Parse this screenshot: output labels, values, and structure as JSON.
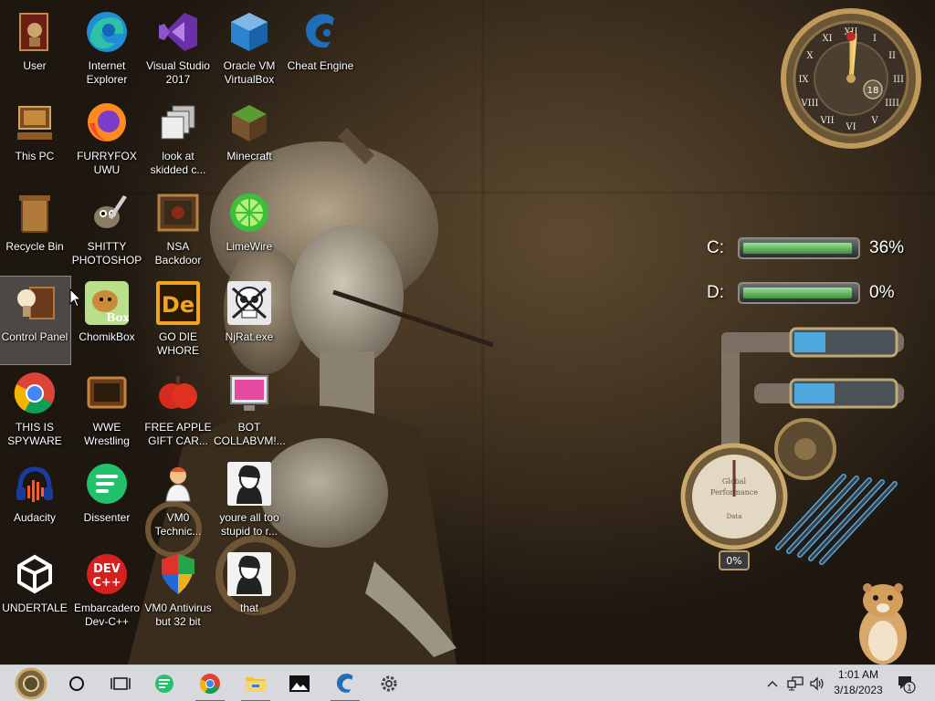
{
  "desktop": {
    "icons": [
      {
        "label": "User",
        "icon": "user-folder-icon"
      },
      {
        "label": "Internet Explorer",
        "icon": "edge-browser-icon"
      },
      {
        "label": "Visual Studio 2017",
        "icon": "visual-studio-icon"
      },
      {
        "label": "Oracle VM VirtualBox",
        "icon": "virtualbox-icon"
      },
      {
        "label": "Cheat Engine",
        "icon": "cheat-engine-icon"
      },
      {
        "label": "This PC",
        "icon": "computer-icon"
      },
      {
        "label": "FURRYFOX UWU",
        "icon": "firefox-icon"
      },
      {
        "label": "look at skidded c...",
        "icon": "shortcut-stack-icon"
      },
      {
        "label": "Minecraft",
        "icon": "minecraft-icon"
      },
      {
        "label": "Recycle Bin",
        "icon": "recycle-bin-icon"
      },
      {
        "label": "SHITTY PHOTOSHOP",
        "icon": "gimp-icon"
      },
      {
        "label": "NSA Backdoor",
        "icon": "steampunk-frame-icon"
      },
      {
        "label": "LimeWire",
        "icon": "limewire-icon"
      },
      {
        "label": "Control Panel",
        "icon": "control-panel-icon"
      },
      {
        "label": "ChomikBox",
        "icon": "chomikbox-icon"
      },
      {
        "label": "GO DIE WHORE",
        "icon": "adobe-de-icon"
      },
      {
        "label": "NjRat.exe",
        "icon": "skull-icon"
      },
      {
        "label": "THIS IS SPYWARE",
        "icon": "chrome-icon"
      },
      {
        "label": "WWE Wrestling",
        "icon": "steampunk-tv-icon"
      },
      {
        "label": "FREE APPLE GIFT CAR...",
        "icon": "red-apple-icon"
      },
      {
        "label": "BOT COLLABVM!...",
        "icon": "monitor-icon"
      },
      {
        "label": "Audacity",
        "icon": "audacity-icon"
      },
      {
        "label": "Dissenter",
        "icon": "dissenter-icon"
      },
      {
        "label": "VM0 Technic...",
        "icon": "technician-icon"
      },
      {
        "label": "youre all too stupid to r...",
        "icon": "portrait-image-icon"
      },
      {
        "label": "UNDERTALE",
        "icon": "unity-icon"
      },
      {
        "label": "Embarcadero Dev-C++",
        "icon": "devcpp-icon"
      },
      {
        "label": "VM0 Antivirus but 32 bit",
        "icon": "shield-icon"
      },
      {
        "label": "that",
        "icon": "portrait-image-icon"
      }
    ],
    "selected_label": "Control Panel"
  },
  "widgets": {
    "clock": {
      "date_number": "18",
      "numerals": [
        "XII",
        "I",
        "II",
        "III",
        "IIII",
        "V",
        "VI",
        "VII",
        "VIII",
        "IX",
        "X",
        "XI"
      ]
    },
    "drives": [
      {
        "letter": "C:",
        "percent": "36%",
        "fill": 0.98
      },
      {
        "letter": "D:",
        "percent": "0%",
        "fill": 0.98
      }
    ],
    "gauge": {
      "top_text": "Global",
      "mid_text": "Performance",
      "bottom_text": "Data",
      "readout": "0%",
      "level": 0.0
    }
  },
  "taskbar": {
    "pinned": [
      "start-orb-icon",
      "cortana-icon",
      "task-view-icon",
      "dissenter-icon",
      "chrome-icon",
      "file-explorer-icon",
      "photos-icon",
      "cheat-engine-icon",
      "settings-icon"
    ],
    "active": [
      "chrome-icon",
      "file-explorer-icon",
      "cheat-engine-icon"
    ],
    "clock_time": "1:01 AM",
    "clock_date": "3/18/2023",
    "notification_count": "1"
  },
  "colors": {
    "taskbar_bg": "#d7d9dd",
    "accent": "#3c74c8",
    "drive_fill": "#5fbf5c"
  }
}
